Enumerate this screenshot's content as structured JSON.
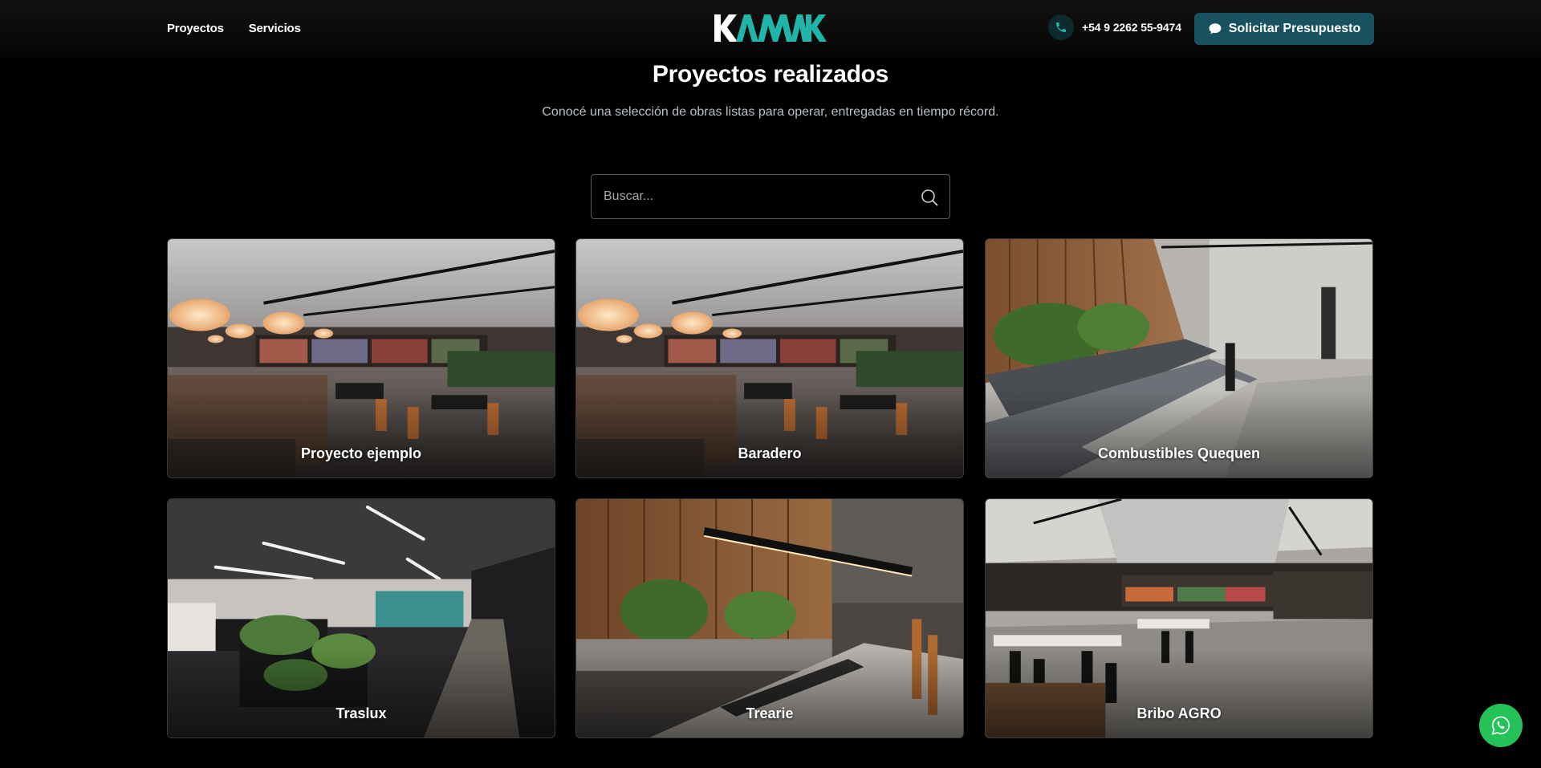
{
  "nav": {
    "links": [
      {
        "label": "Proyectos"
      },
      {
        "label": "Servicios"
      }
    ]
  },
  "brand": {
    "logo_text": "KAMAK",
    "accent": "#1fb5a8"
  },
  "contact": {
    "phone": "+54 9 2262 55-9474",
    "cta_label": "Solicitar Presupuesto",
    "cta_color": "#17525e"
  },
  "hero": {
    "title": "Proyectos realizados",
    "subtitle": "Conocé una selección de obras listas para operar, entregadas en tiempo récord."
  },
  "search": {
    "placeholder": "Buscar...",
    "value": ""
  },
  "projects": [
    {
      "name": "Proyecto ejemplo",
      "scene": "cafe-pendants"
    },
    {
      "name": "Baradero",
      "scene": "cafe-pendants"
    },
    {
      "name": "Combustibles Quequen",
      "scene": "booths-wood"
    },
    {
      "name": "Traslux",
      "scene": "store-planters"
    },
    {
      "name": "Trearie",
      "scene": "wood-table"
    },
    {
      "name": "Bribo AGRO",
      "scene": "dining-hall"
    }
  ],
  "whatsapp": {
    "icon": "whatsapp-icon",
    "color": "#25c25a"
  }
}
